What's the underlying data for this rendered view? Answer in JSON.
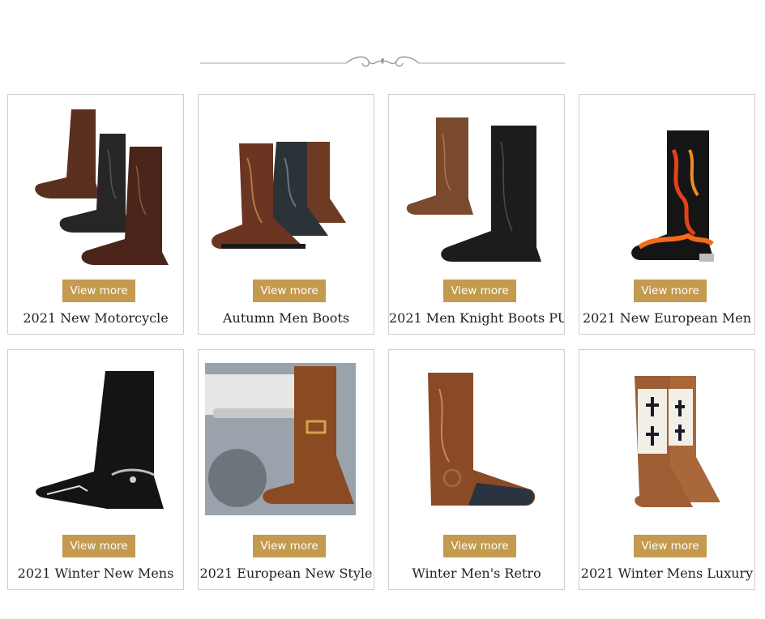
{
  "products": [
    {
      "name": "2021 New Motorcycle",
      "button": "View more",
      "image": "three-leather-western-boots"
    },
    {
      "name": "Autumn Men Boots",
      "button": "View more",
      "image": "three-cowboy-boots-group"
    },
    {
      "name": "2021 Men Knight Boots PU",
      "button": "View more",
      "image": "brown-and-black-boots-pair"
    },
    {
      "name": "2021 New European Men",
      "button": "View more",
      "image": "flame-pattern-boot"
    },
    {
      "name": "2021 Winter New Mens",
      "button": "View more",
      "image": "black-harness-boot"
    },
    {
      "name": "2021 European New Style",
      "button": "View more",
      "image": "boot-on-motorcycle"
    },
    {
      "name": "Winter Men's Retro",
      "button": "View more",
      "image": "brown-harness-boot"
    },
    {
      "name": "2021 Winter Mens Luxury",
      "button": "View more",
      "image": "white-cross-boots"
    }
  ],
  "colors": {
    "button_bg": "#c49a4e",
    "button_text": "#ffffff",
    "card_border": "#cfcfcf"
  }
}
